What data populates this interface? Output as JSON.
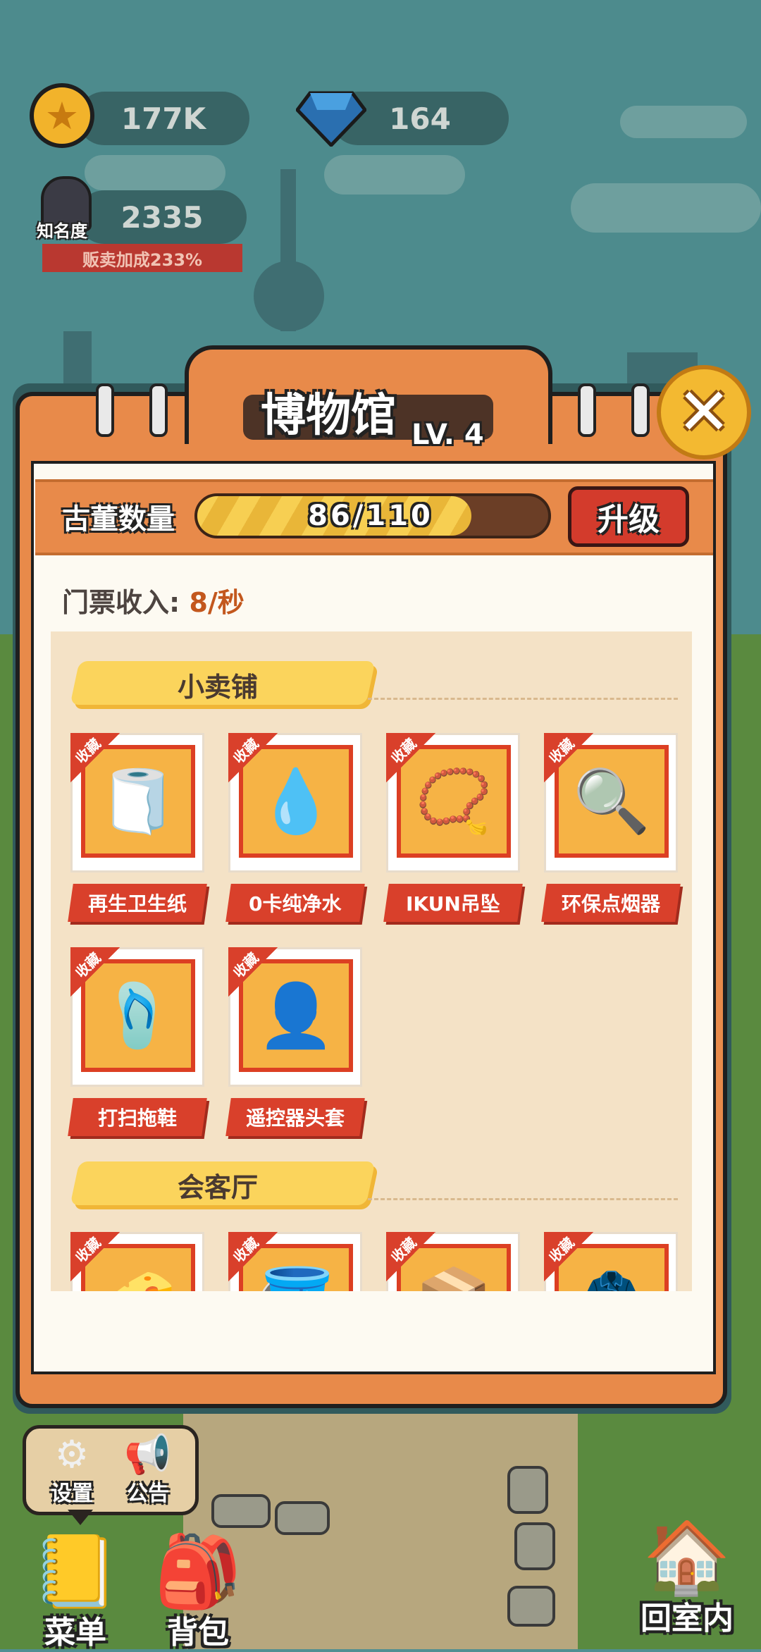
{
  "hud": {
    "coins": "177K",
    "gems": "164",
    "fame_label": "知名度",
    "fame_value": "2335",
    "sales_bonus": "贩卖加成233%",
    "colors": {
      "coin": "#f2b32b",
      "gem": "#2a6fb0",
      "bonus_banner": "#b93830"
    }
  },
  "museum": {
    "title": "博物馆",
    "level": "LV. 4",
    "close_icon": "close-x-icon",
    "antique_label": "古董数量",
    "antique_progress": {
      "current": 86,
      "total": 110,
      "text": "86/110"
    },
    "upgrade_label": "升级",
    "income_label": "门票收入:",
    "income_value": "8/秒",
    "colors": {
      "panel": "#e88a4a",
      "progress": "#f7cf52",
      "upgrade_button": "#d33b2c",
      "card_frame": "#dc3f23"
    },
    "sections": [
      {
        "title": "小卖铺",
        "items": [
          {
            "tag": "收藏",
            "name": "再生卫生纸",
            "icon": "toilet-paper-icon",
            "glyph": "🧻"
          },
          {
            "tag": "收藏",
            "name": "0卡纯净水",
            "icon": "water-bottle-icon",
            "glyph": "💧"
          },
          {
            "tag": "收藏",
            "name": "IKUN吊坠",
            "icon": "necklace-icon",
            "glyph": "📿"
          },
          {
            "tag": "收藏",
            "name": "环保点烟器",
            "icon": "lighter-magnifier-icon",
            "glyph": "🔍"
          },
          {
            "tag": "收藏",
            "name": "打扫拖鞋",
            "icon": "slippers-icon",
            "glyph": "🩴"
          },
          {
            "tag": "收藏",
            "name": "遥控器头套",
            "icon": "locked-silhouette-icon",
            "glyph": "👤"
          }
        ]
      },
      {
        "title": "会客厅",
        "items": [
          {
            "tag": "收藏",
            "icon": "cheese-icon",
            "glyph": "🧀"
          },
          {
            "tag": "收藏",
            "icon": "bucket-icon",
            "glyph": "🪣"
          },
          {
            "tag": "收藏",
            "icon": "snack-box-icon",
            "glyph": "📦"
          },
          {
            "tag": "收藏",
            "icon": "jacket-icon",
            "glyph": "🧥"
          }
        ]
      }
    ]
  },
  "bottom_nav": {
    "settings_label": "设置",
    "notice_label": "公告",
    "menu_label": "菜单",
    "bag_label": "背包",
    "home_label": "回室内"
  }
}
